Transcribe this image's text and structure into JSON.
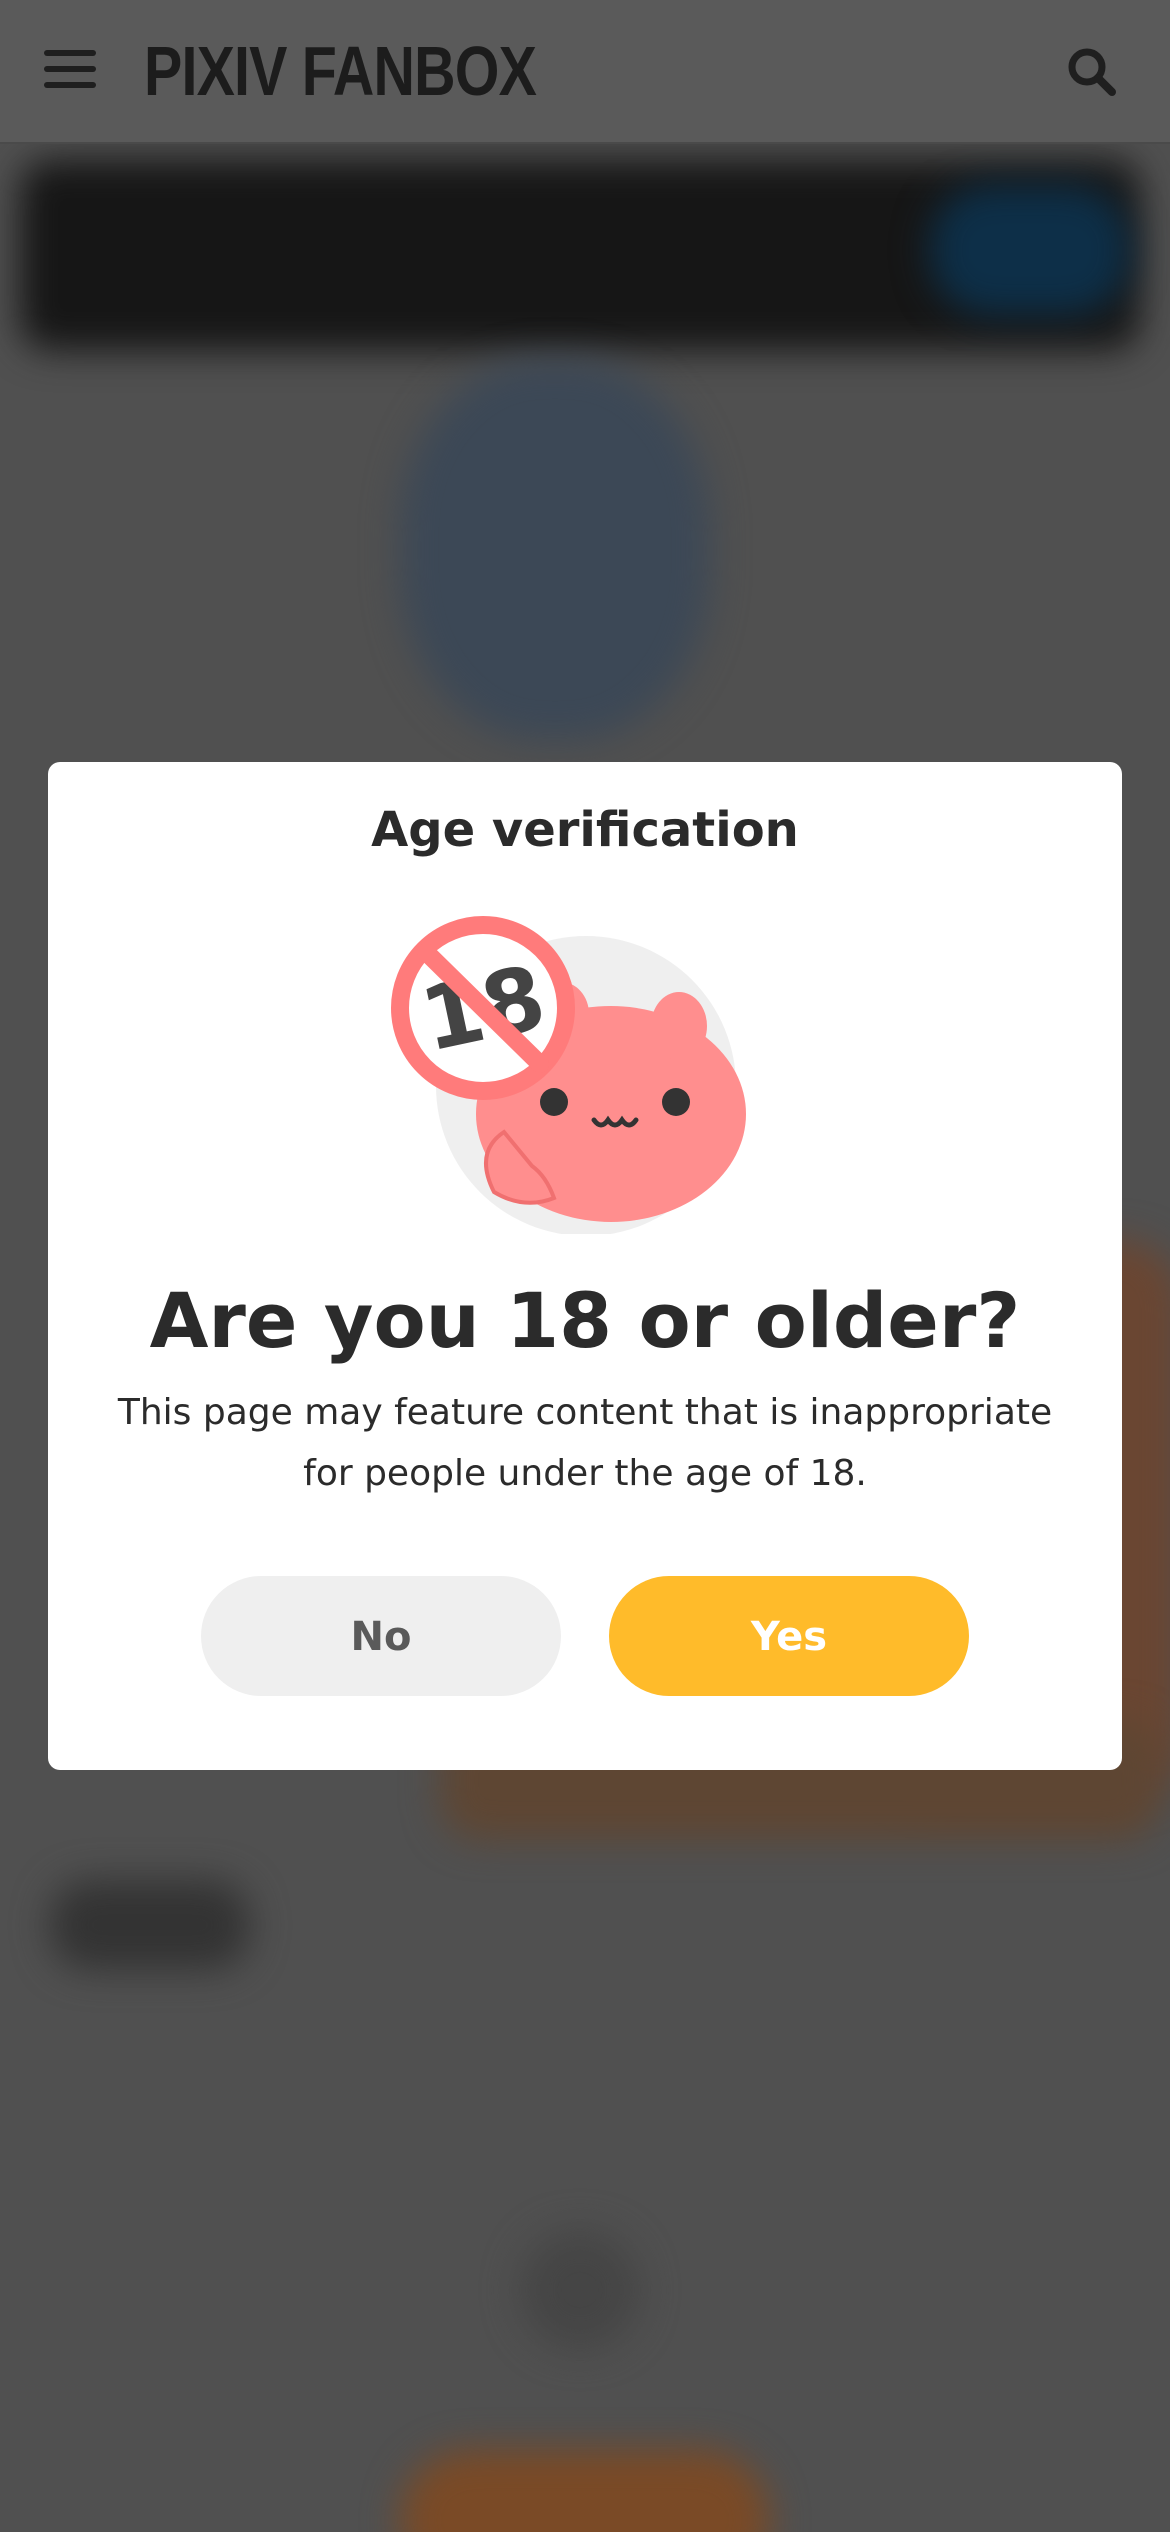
{
  "header": {
    "logo": "PIXIV FANBOX",
    "menu_icon": "hamburger-menu-icon",
    "search_icon": "search-icon"
  },
  "modal": {
    "title": "Age verification",
    "illustration": "18-plus-prohibited-mascot-icon",
    "question": "Are you 18 or older?",
    "description": "This page may feature content that is inappropriate for people under the age of 18.",
    "no_label": "No",
    "yes_label": "Yes"
  },
  "colors": {
    "accent": "#ffbb2a",
    "no_button": "#efefef",
    "text": "#2b2b2b",
    "overlay": "#505050"
  }
}
